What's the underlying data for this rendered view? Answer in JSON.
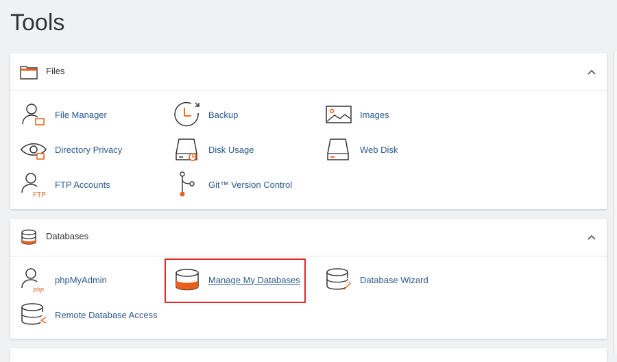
{
  "page": {
    "title": "Tools"
  },
  "panels": [
    {
      "title": "Files",
      "header_icon": "folder-icon",
      "items": [
        {
          "label": "File Manager",
          "icon": "file-manager-icon"
        },
        {
          "label": "Backup",
          "icon": "backup-icon"
        },
        {
          "label": "Images",
          "icon": "images-icon"
        },
        {
          "label": "Directory Privacy",
          "icon": "directory-privacy-icon"
        },
        {
          "label": "Disk Usage",
          "icon": "disk-usage-icon"
        },
        {
          "label": "Web Disk",
          "icon": "web-disk-icon"
        },
        {
          "label": "FTP Accounts",
          "icon": "ftp-accounts-icon",
          "icon_text": "FTP"
        },
        {
          "label": "Git™ Version Control",
          "icon": "git-icon"
        }
      ]
    },
    {
      "title": "Databases",
      "header_icon": "database-icon",
      "items": [
        {
          "label": "phpMyAdmin",
          "icon": "phpmyadmin-icon",
          "icon_text": "php"
        },
        {
          "label": "Manage My Databases",
          "icon": "manage-databases-icon",
          "highlighted": true
        },
        {
          "label": "Database Wizard",
          "icon": "database-wizard-icon"
        },
        {
          "label": "Remote Database Access",
          "icon": "remote-database-icon"
        }
      ]
    }
  ],
  "colors": {
    "accent": "#e8601c",
    "link": "#2b5a8e",
    "highlight": "#e02b2b"
  }
}
